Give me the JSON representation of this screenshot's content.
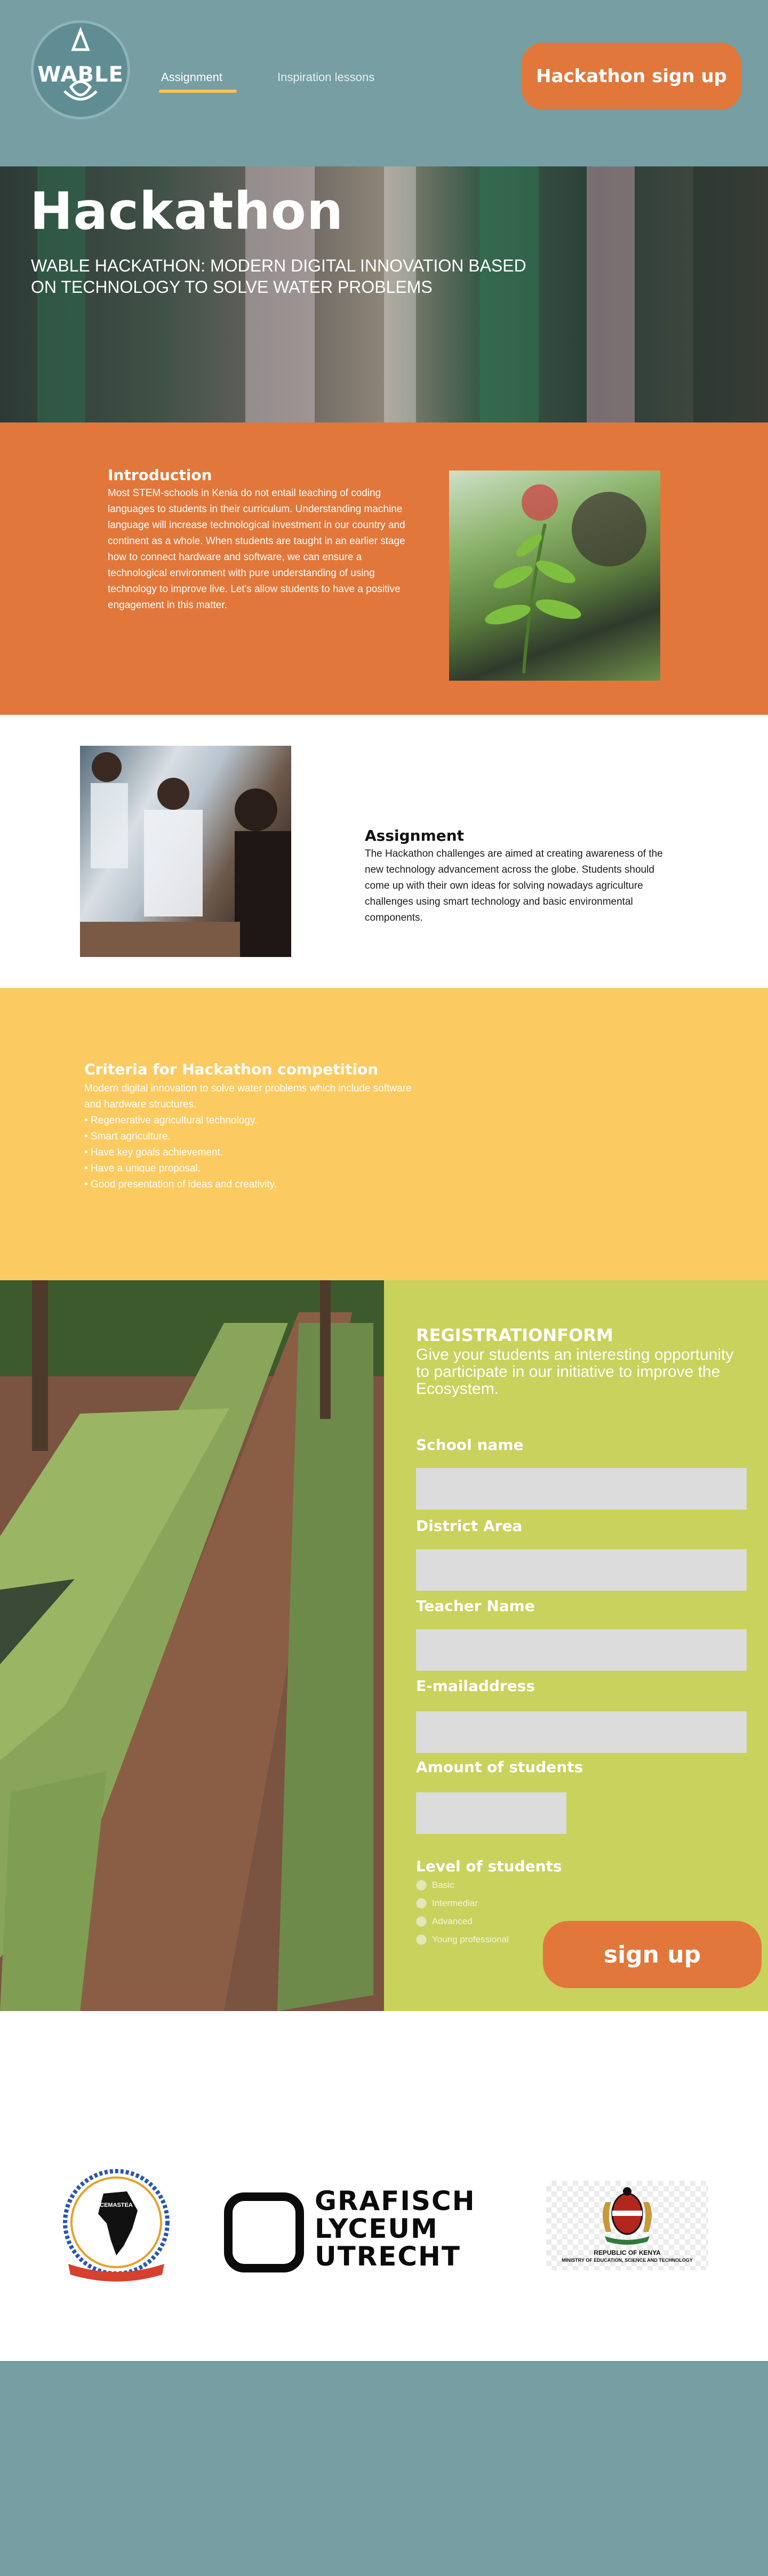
{
  "header": {
    "logo_text": "WABLE",
    "nav": [
      {
        "label": "Assignment"
      },
      {
        "label": "Inspiration lessons"
      }
    ],
    "signup_label": "Hackathon sign up"
  },
  "hero": {
    "title": "Hackathon",
    "subtitle": "WABLE HACKATHON: MODERN DIGITAL INNOVATION BASED ON TECHNOLOGY TO SOLVE WATER PROBLEMS"
  },
  "intro": {
    "title": "Introduction",
    "body": "Most STEM-schools in Kenia do not entail teaching of coding languages to students in their curriculum. Understanding machine language will increase technological investment in our country and continent as a whole. When students are taught in an earlier stage how to connect hardware and software, we can ensure a technological environment with pure understanding of using technology to improve live. Let's allow students to have a positive engagement in this matter."
  },
  "assignment": {
    "title": "Assignment",
    "body": "The Hackathon challenges are aimed at creating awareness of the new technology advancement across the globe. Students should come up with their own ideas for solving nowadays agriculture challenges using smart technology and basic environmental components."
  },
  "criteria": {
    "title": "Criteria for Hackathon competition",
    "lines": [
      "Modern digital innovation to solve water problems which include software",
      "and hardware structures.",
      "• Regenerative agricultural technology.",
      "• Smart agriculture.",
      "• Have key goals achievement.",
      "• Have a unique proposal.",
      "• Good presentation of ideas and creativity."
    ]
  },
  "registration": {
    "title": "REGISTRATIONFORM",
    "subtitle": "Give your students an interesting opportunity to participate in our initiative to improve the Ecosystem.",
    "fields": [
      {
        "label": "School name",
        "value": ""
      },
      {
        "label": "District Area",
        "value": ""
      },
      {
        "label": "Teacher Name",
        "value": ""
      },
      {
        "label": "E-mailaddress",
        "value": ""
      },
      {
        "label": "Amount of students",
        "value": ""
      }
    ],
    "level_label": "Level of students",
    "levels": [
      "Basic",
      "Intermediar",
      "Advanced",
      "Young professional"
    ],
    "signup_label": "sign up"
  },
  "partners": {
    "grafisch_lines": [
      "GRAFISCH",
      "LYCEUM",
      "UTRECHT"
    ],
    "kenya_line1": "REPUBLIC OF KENYA",
    "kenya_line2": "MINISTRY OF EDUCATION, SCIENCE AND TECHNOLOGY",
    "cemastea_text": "CEMASTEA"
  },
  "colors": {
    "teal": "#769ea3",
    "orange": "#e2773b",
    "yellow": "#fbcb62",
    "lime": "#c8d25d",
    "nav_underline": "#f6c54f"
  }
}
